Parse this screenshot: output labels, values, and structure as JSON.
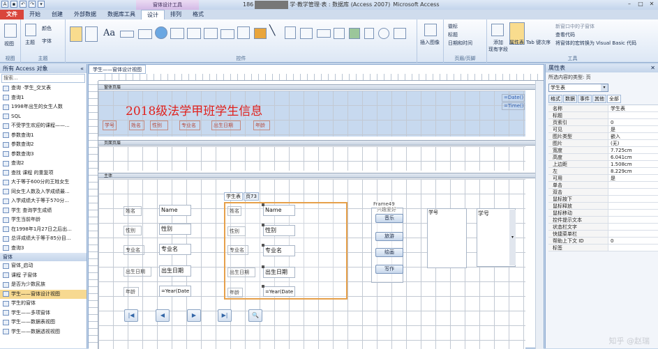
{
  "window": {
    "title_prefix": "186",
    "title_suffix": "学·教学管理·表 : 数据库 (Access 2007)",
    "app_suffix": "Microsoft Access",
    "context_tools": "窗体设计工具"
  },
  "tabs": [
    "文件",
    "开始",
    "创建",
    "外部数据",
    "数据库工具",
    "设计",
    "排列",
    "格式"
  ],
  "ribbon": {
    "groups": [
      "视图",
      "主题",
      "控件",
      "页眉/页脚",
      "工具"
    ],
    "view_label": "视图",
    "theme_label": "主题",
    "colors_label": "颜色",
    "fonts_label": "字体",
    "insert_image": "插入图像",
    "header_items": [
      "徽标",
      "标题",
      "日期和时间"
    ],
    "add_fields": "添加\n现有字段",
    "property_sheet": "属性表",
    "tab_order": "Tab 键次序",
    "tool_items": [
      "新窗口中的子窗体",
      "查看代码",
      "将窗体的宏转换为 Visual Basic 代码"
    ]
  },
  "nav": {
    "header": "所有 Access 对象",
    "search_placeholder": "搜索...",
    "items": [
      "查询 ·学生_交叉表",
      "查询1",
      "1998年出生的女生人数",
      "SQL",
      "不受学生欢迎的课程——...",
      "参数查询1",
      "参数查询2",
      "参数查询3",
      "查询2",
      "查找 课程 的重复项",
      "大于等于600分的王姓女生",
      "同女生人数及入学成绩最...",
      "入学成绩大于等于570分...",
      "学生 查询学生成绩",
      "学生当前年龄",
      "在1998年1月27日之后出...",
      "总评成绩大于等于85分目...",
      "查询3"
    ],
    "forms_section": "窗体",
    "form_items": [
      "窗体_启动",
      "课程 子窗体",
      "是否为少数民族",
      "学生——窗体设计视图",
      "学生的窗体",
      "学生——多项窗体",
      "学生——数据表视图",
      "学生——数据透视视图"
    ],
    "selected_form_index": 3
  },
  "document": {
    "tab": "学生——窗体设计视图",
    "sections": [
      "窗体页眉",
      "页面页眉",
      "主体"
    ],
    "form_title": "2018级法学甲班学生信息",
    "date_field": "=Date()",
    "time_field": "=Time()",
    "header_labels": [
      "学号",
      "姓名",
      "性别",
      "专业名",
      "出生日期",
      "年龄"
    ],
    "detail_labels": [
      "姓名",
      "性别",
      "专业名",
      "出生日期",
      "年龄"
    ],
    "detail_fields": [
      "Name",
      "性别",
      "专业名",
      "出生日期",
      "=Year(Date"
    ],
    "tab_control": {
      "tabs": [
        "学生表",
        "页73"
      ],
      "labels": [
        "姓名",
        "性别",
        "专业名",
        "出生日期",
        "年龄"
      ],
      "fields": [
        "Name",
        "性别",
        "专业名",
        "出生日期",
        "=Year(Date"
      ]
    },
    "frame_label": "Frame49",
    "frame_inner": "兴趣爱好",
    "option_buttons": [
      "音乐",
      "旅游",
      "绘画",
      "写作"
    ],
    "list_label": "学号",
    "combo_label": "学号",
    "nav_buttons": [
      "|◀",
      "◀",
      "▶",
      "▶|",
      "🔍"
    ]
  },
  "props": {
    "title": "属性表",
    "selection_type_label": "所选内容的类型: 页",
    "object": "学生表",
    "tabs": [
      "格式",
      "数据",
      "事件",
      "其他",
      "全部"
    ],
    "rows": [
      [
        "名称",
        "学生表"
      ],
      [
        "标题",
        ""
      ],
      [
        "页索引",
        "0"
      ],
      [
        "可见",
        "是"
      ],
      [
        "图片类型",
        "嵌入"
      ],
      [
        "图片",
        "(无)"
      ],
      [
        "宽度",
        "7.725cm"
      ],
      [
        "高度",
        "6.041cm"
      ],
      [
        "上边距",
        "1.508cm"
      ],
      [
        "左",
        "8.229cm"
      ],
      [
        "可用",
        "是"
      ],
      [
        "单击",
        ""
      ],
      [
        "双击",
        ""
      ],
      [
        "鼠标按下",
        ""
      ],
      [
        "鼠标释放",
        ""
      ],
      [
        "鼠标移动",
        ""
      ],
      [
        "控件提示文本",
        ""
      ],
      [
        "状态栏文字",
        ""
      ],
      [
        "快捷菜单栏",
        ""
      ],
      [
        "帮助上下文 ID",
        "0"
      ],
      [
        "标签",
        ""
      ]
    ]
  },
  "watermark": "知乎 @赵瑞",
  "colors": {
    "file_tab": "#d9453b",
    "title_red": "#e0211d",
    "header_bg": "#c7d9ef",
    "selected": "#f7d991"
  }
}
